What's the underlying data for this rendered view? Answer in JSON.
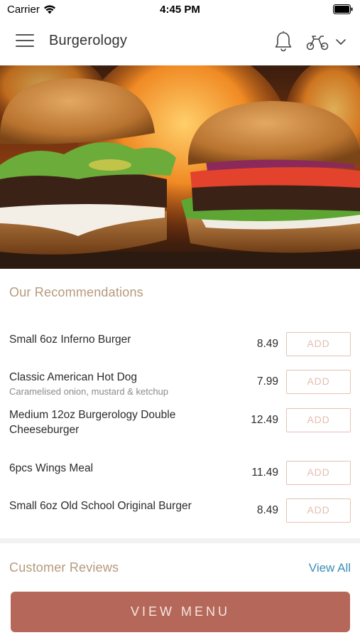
{
  "status_bar": {
    "carrier": "Carrier",
    "time": "4:45 PM"
  },
  "nav": {
    "title": "Burgerology",
    "icons": [
      "hamburger-menu-icon",
      "bell-icon",
      "scooter-icon",
      "chevron-down-icon"
    ]
  },
  "hero": {
    "image": "two-burgers-over-flames"
  },
  "recommendations": {
    "title": "Our Recommendations",
    "add_label": "ADD",
    "items": [
      {
        "name": "Small 6oz Inferno Burger",
        "description": "",
        "price": "8.49"
      },
      {
        "name": "Classic American Hot Dog",
        "description": "Caramelised onion, mustard & ketchup",
        "price": "7.99"
      },
      {
        "name": "Medium 12oz Burgerology Double Cheeseburger",
        "description": "",
        "price": "12.49"
      },
      {
        "name": "6pcs Wings Meal",
        "description": "",
        "price": "11.49"
      },
      {
        "name": "Small 6oz Old School Original Burger",
        "description": "",
        "price": "8.49"
      }
    ]
  },
  "reviews": {
    "title": "Customer Reviews",
    "view_all": "View All"
  },
  "footer": {
    "view_menu": "VIEW MENU"
  },
  "colors": {
    "accent_brown": "#b5685a",
    "section_title": "#b59a7c",
    "link_blue": "#3a8fb7",
    "add_border": "#e5c1b4"
  }
}
